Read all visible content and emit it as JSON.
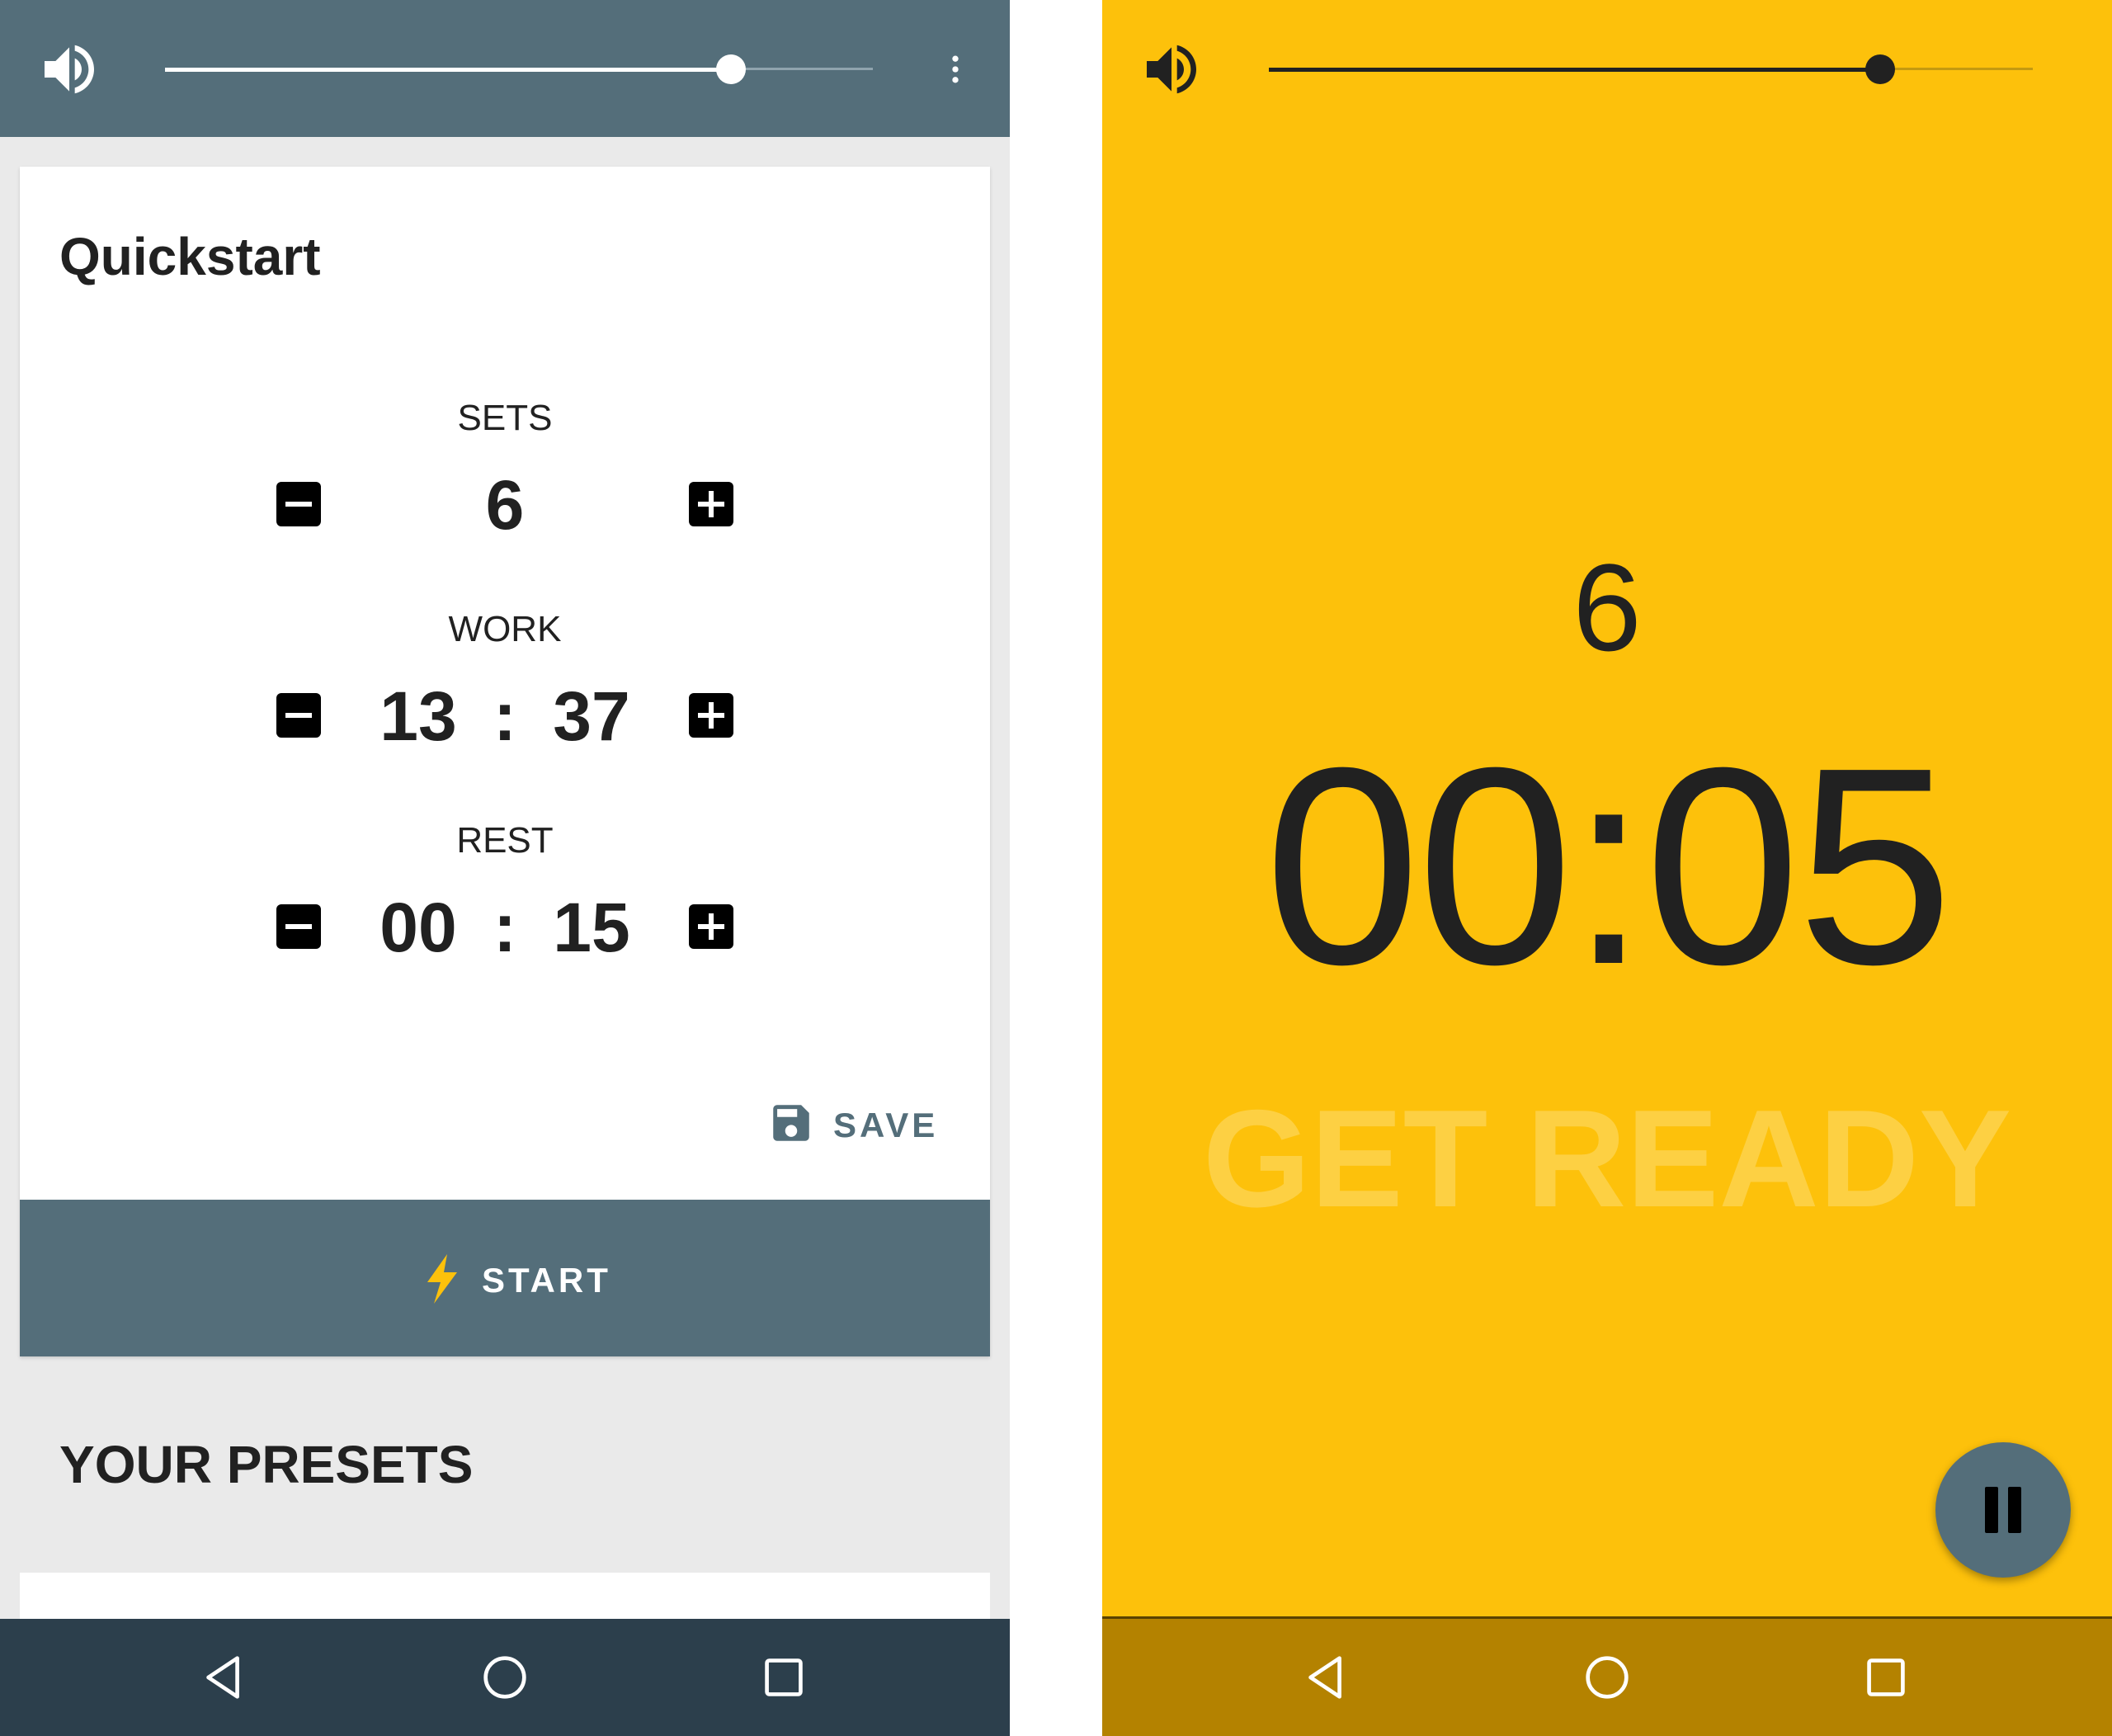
{
  "colors": {
    "toolbar": "#546e7a",
    "nav_left": "#2c3f4c",
    "accent_yellow": "#fdc10b",
    "nav_right": "#b48200",
    "bolt": "#fdc10b"
  },
  "left": {
    "volume_icon": "volume-up-icon",
    "volume_level": 0.8,
    "menu_icon": "more-vert-icon",
    "quickstart": {
      "title": "Quickstart",
      "sets": {
        "label": "SETS",
        "value": "6"
      },
      "work": {
        "label": "WORK",
        "minutes": "13",
        "sep": ":",
        "seconds": "37"
      },
      "rest": {
        "label": "REST",
        "minutes": "00",
        "sep": ":",
        "seconds": "15"
      },
      "decrement_icon": "minus-box-icon",
      "increment_icon": "plus-box-icon",
      "save": {
        "label": "SAVE",
        "icon": "floppy-disk-icon"
      },
      "start": {
        "label": "START",
        "icon": "lightning-bolt-icon"
      }
    },
    "presets_title": "YOUR PRESETS",
    "nav": [
      "back-icon",
      "home-icon",
      "recents-icon"
    ]
  },
  "right": {
    "volume_icon": "volume-up-icon",
    "volume_level": 0.8,
    "set_count": "6",
    "timer": "00:05",
    "phase": "GET READY",
    "pause_icon": "pause-icon",
    "nav": [
      "back-icon",
      "home-icon",
      "recents-icon"
    ]
  }
}
